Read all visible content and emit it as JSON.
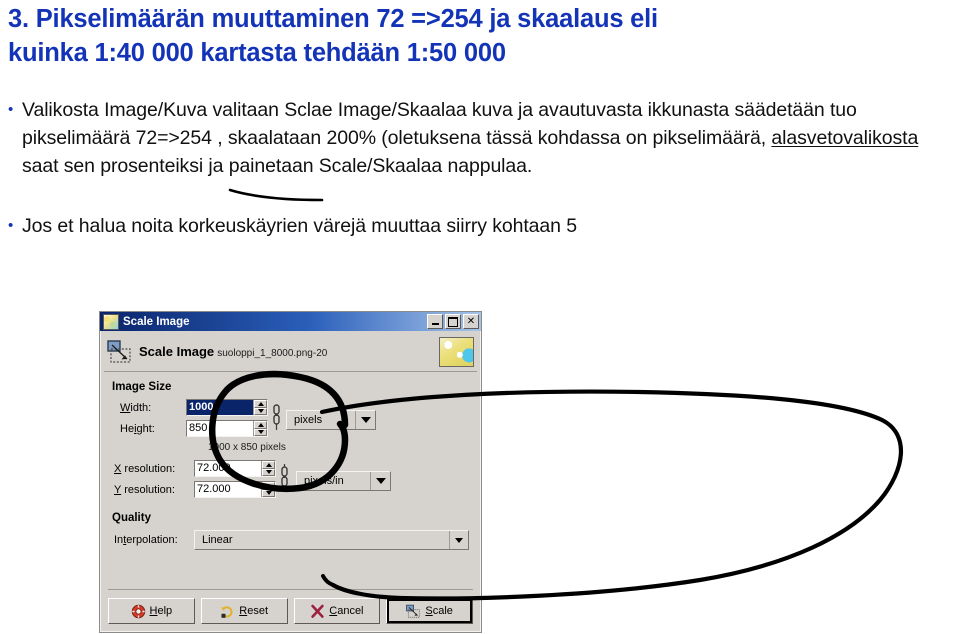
{
  "slide": {
    "heading_line1": "3. Pikselimäärän muuttaminen 72 =>254 ja skaalaus eli",
    "heading_line2": "kuinka 1:40 000 kartasta tehdään 1:50 000",
    "heading_color": "#1434b8",
    "bullets": [
      {
        "marker": "•",
        "segments": [
          {
            "text": "Valikosta Image/Kuva valitaan Sclae Image/Skaalaa kuva ja avautuvasta ikkunasta säädetään tuo pikselimäärä 72=>254 , skaalataan 200% (oletuksena tässä kohdassa on pikselimäärä, ",
            "underline": false
          },
          {
            "text": "alasvetovalikosta",
            "underline": true
          },
          {
            "text": " saat sen prosenteiksi ja painetaan Scale/Skaalaa nappulaa.",
            "underline": false
          }
        ]
      },
      {
        "marker": "•",
        "segments": [
          {
            "text": "Jos et halua noita korkeuskäyrien värejä muuttaa siirry kohtaan 5",
            "underline": false
          }
        ]
      }
    ]
  },
  "dialog": {
    "titlebar": {
      "title": "Scale Image",
      "icon": "image-thumbnail-icon",
      "minimize_label": "_",
      "maximize_label": "□",
      "close_label": "✕"
    },
    "header": {
      "title": "Scale Image",
      "subtitle": "suoloppi_1_8000.png-20",
      "icon": "scale-image-icon",
      "thumbnail": "map-preview-thumbnail"
    },
    "image_size": {
      "group_label": "Image Size",
      "width": {
        "label": "Width:",
        "label_mnemonic": "W",
        "value": "1000",
        "selected": true
      },
      "height": {
        "label": "Height:",
        "label_mnemonic": "i",
        "value": "850",
        "selected": false
      },
      "size_unit": "pixels",
      "summary": "1000 x 850 pixels",
      "x_resolution": {
        "label": "X resolution:",
        "label_mnemonic": "X",
        "value": "72.000"
      },
      "y_resolution": {
        "label": "Y resolution:",
        "label_mnemonic": "Y",
        "value": "72.000"
      },
      "resolution_unit": "pixels/in",
      "chain_icon": "chain-link-icon"
    },
    "quality": {
      "group_label": "Quality",
      "interpolation_label": "Interpolation:",
      "interpolation_value": "Linear"
    },
    "buttons": [
      {
        "label": "Help",
        "mnemonic": "H",
        "icon": "help-lifering-icon",
        "default": false
      },
      {
        "label": "Reset",
        "mnemonic": "R",
        "icon": "reset-icon",
        "default": false
      },
      {
        "label": "Cancel",
        "mnemonic": "C",
        "icon": "cancel-x-icon",
        "default": false
      },
      {
        "label": "Scale",
        "mnemonic": "S",
        "icon": "scale-icon",
        "default": true
      }
    ]
  },
  "annotation": {
    "name": "handdrawn-circle-and-lasso",
    "color": "#000000"
  }
}
